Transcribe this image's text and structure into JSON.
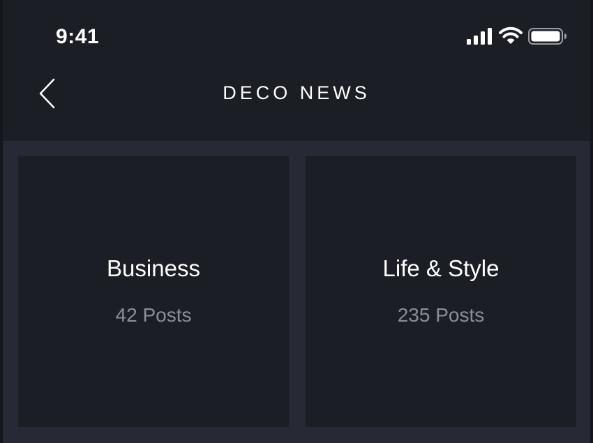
{
  "status": {
    "time": "9:41",
    "icons": [
      "signal-icon",
      "wifi-icon",
      "battery-icon"
    ]
  },
  "nav": {
    "title": "DECO NEWS",
    "back_icon": "chevron-left-icon"
  },
  "categories": [
    {
      "title": "Business",
      "count": "42 Posts"
    },
    {
      "title": "Life & Style",
      "count": "235 Posts"
    }
  ],
  "colors": {
    "background": "#272a34",
    "card": "#1c1e26",
    "text_primary": "#ffffff",
    "text_secondary": "#8b8e99"
  }
}
